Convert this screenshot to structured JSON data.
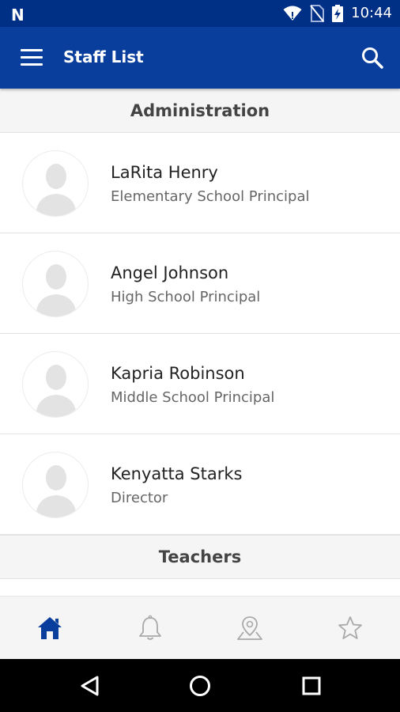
{
  "status_bar": {
    "logo": "N",
    "time": "10:44",
    "icons": [
      "wifi-icon",
      "no-sim-icon",
      "battery-charging-icon"
    ]
  },
  "app_bar": {
    "title": "Staff List",
    "menu_icon": "hamburger-menu-icon",
    "search_icon": "search-icon"
  },
  "sections": [
    {
      "title": "Administration",
      "staff": [
        {
          "name": "LaRita Henry",
          "role": "Elementary School Principal"
        },
        {
          "name": "Angel Johnson",
          "role": "High School Principal"
        },
        {
          "name": "Kapria Robinson",
          "role": "Middle School Principal"
        },
        {
          "name": "Kenyatta Starks",
          "role": "Director"
        }
      ]
    },
    {
      "title": "Teachers",
      "staff": []
    }
  ],
  "bottom_nav": {
    "items": [
      "home-icon",
      "bell-icon",
      "map-pin-icon",
      "star-icon"
    ],
    "active": "home-icon"
  },
  "system_nav": [
    "back-icon",
    "home-circle-icon",
    "recents-icon"
  ],
  "colors": {
    "status_bar": "#002f86",
    "app_bar": "#0a3e9c",
    "active_nav": "#0a3e9c",
    "inactive_nav": "#a9a9a9"
  }
}
